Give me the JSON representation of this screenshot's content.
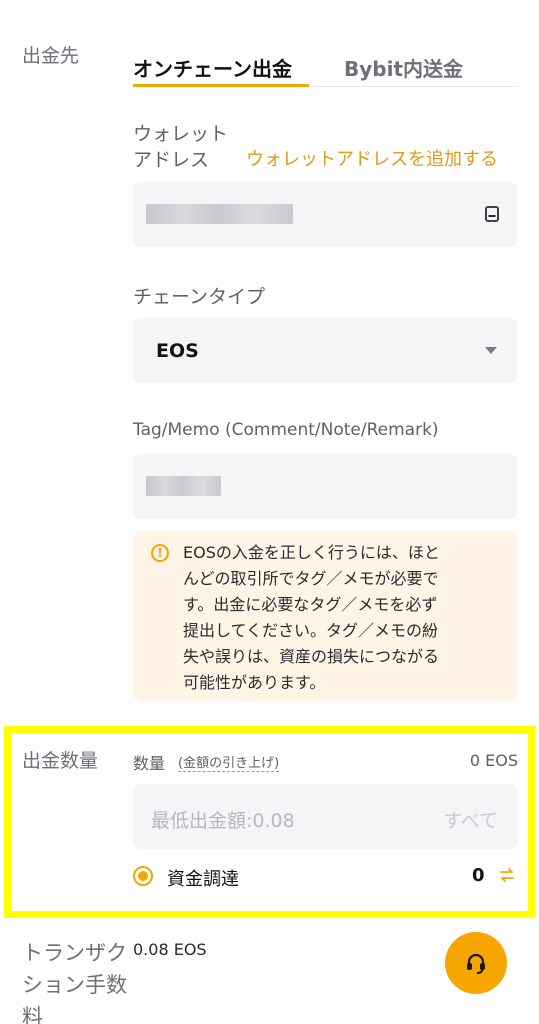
{
  "withdraw_to": {
    "label": "出金先",
    "tabs": [
      {
        "label": "オンチェーン出金",
        "active": true
      },
      {
        "label": "Bybit内送金",
        "active": false
      }
    ]
  },
  "wallet_address": {
    "label_line1": "ウォレット",
    "label_line2": "アドレス",
    "add_link": "ウォレットアドレスを追加する",
    "book_icon": "address-book-icon"
  },
  "chain_type": {
    "label": "チェーンタイプ",
    "value": "EOS"
  },
  "tag_memo": {
    "label": "Tag/Memo (Comment/Note/Remark)"
  },
  "warning": {
    "lines": [
      "EOSの入金を正しく行うには、ほと",
      "んどの取引所でタグ／メモが必要で",
      "す。出金に必要なタグ／メモを必ず",
      "提出してください。タグ／メモの紛",
      "失や誤りは、資産の損失につながる",
      "可能性があります。"
    ]
  },
  "amount": {
    "section_label": "出金数量",
    "field_label": "数量",
    "raise_link": "(金額の引き上げ)",
    "balance": "0 EOS",
    "placeholder": "最低出金額:0.08",
    "all_label": "すべて",
    "funding_label": "資金調達",
    "funding_value": "0"
  },
  "fee": {
    "label_line1": "トランザク",
    "label_line2": "ション手数",
    "label_line3": "料",
    "value": "0.08 EOS"
  },
  "colors": {
    "accent": "#f7a600",
    "highlight": "#ffff00",
    "link": "#e19a15"
  }
}
